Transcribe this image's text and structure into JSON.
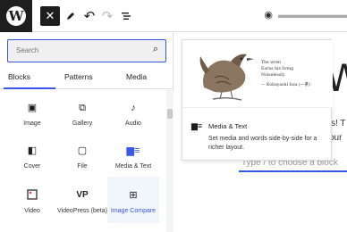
{
  "toolbar": {
    "logo_glyph": "W",
    "close_icon": "close-icon",
    "pen_icon": "pen-icon",
    "undo_icon": "undo-icon",
    "redo_icon": "redo-icon",
    "list_icon": "list-view-icon"
  },
  "inserter": {
    "search_placeholder": "Search",
    "tabs": [
      {
        "label": "Blocks",
        "active": true
      },
      {
        "label": "Patterns",
        "active": false
      },
      {
        "label": "Media",
        "active": false
      }
    ],
    "blocks": [
      {
        "label": "Image",
        "icon": "image-icon",
        "glyph": "▣"
      },
      {
        "label": "Gallery",
        "icon": "gallery-icon",
        "glyph": "⧉"
      },
      {
        "label": "Audio",
        "icon": "audio-icon",
        "glyph": "♪"
      },
      {
        "label": "Cover",
        "icon": "cover-icon",
        "glyph": "◧"
      },
      {
        "label": "File",
        "icon": "file-icon",
        "glyph": "▢"
      },
      {
        "label": "Media & Text",
        "icon": "media-text-icon",
        "glyph": "▆≡"
      },
      {
        "label": "Video",
        "icon": "video-icon",
        "glyph": "⊡"
      },
      {
        "label": "VideoPress (beta)",
        "icon": "videopress-icon",
        "glyph": "VP"
      },
      {
        "label": "Image Compare",
        "icon": "image-compare-icon",
        "glyph": "⊞"
      }
    ]
  },
  "preview": {
    "haiku_lines": [
      "The wren",
      "Earns his living",
      "Noiselessly."
    ],
    "haiku_author": "— Kobayashi Issa (一茶)",
    "title": "Media & Text",
    "description": "Set media and words side-by-side for a richer layout."
  },
  "canvas": {
    "appender_placeholder": "Type / to choose a block",
    "ghost_heading": "W",
    "ghost_line1": "s! T",
    "ghost_line2": "our"
  },
  "colors": {
    "accent": "#3858e9",
    "dark": "#1e1e1e"
  }
}
